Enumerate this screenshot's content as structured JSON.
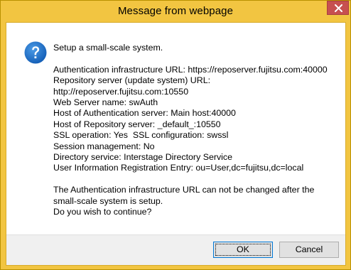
{
  "window": {
    "title": "Message from webpage"
  },
  "message": {
    "lines": [
      "Setup a small-scale system.",
      "",
      "Authentication infrastructure URL: https://reposerver.fujitsu.com:40000",
      "Repository server (update system) URL:",
      "http://reposerver.fujitsu.com:10550",
      "Web Server name: swAuth",
      "Host of Authentication server: Main host:40000",
      "Host of Repository server: _default_:10550",
      "SSL operation: Yes  SSL configuration: swssl",
      "Session management: No",
      "Directory service: Interstage Directory Service",
      "User Information Registration Entry: ou=User,dc=fujitsu,dc=local",
      "",
      "The Authentication infrastructure URL can not be changed after the",
      "small-scale system is setup.",
      "Do you wish to continue?"
    ]
  },
  "buttons": {
    "ok_label": "OK",
    "cancel_label": "Cancel"
  },
  "icons": {
    "dialog_icon": "question-icon",
    "close": "close-icon"
  },
  "colors": {
    "frame": "#f2c541",
    "close_button": "#c75050",
    "question_icon": "#1e6fc4"
  }
}
